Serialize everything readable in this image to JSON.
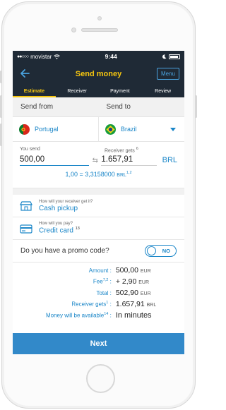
{
  "status_bar": {
    "carrier": "movistar",
    "time": "9:44"
  },
  "header": {
    "title": "Send money",
    "menu_label": "Menu"
  },
  "tabs": [
    {
      "label": "Estimate",
      "active": true
    },
    {
      "label": "Receiver",
      "active": false
    },
    {
      "label": "Payment",
      "active": false
    },
    {
      "label": "Review",
      "active": false
    }
  ],
  "send": {
    "from_label": "Send from",
    "to_label": "Send to",
    "from_country": "Portugal",
    "to_country": "Brazil"
  },
  "amounts": {
    "you_send_label": "You send",
    "receiver_gets_label": "Receiver gets",
    "receiver_gets_sup": "6",
    "you_send_value": "500,00",
    "receiver_gets_value": "1.657,91",
    "currency": "BRL",
    "rate_text": "1,00 = 3,3158000",
    "rate_currency": "BRL",
    "rate_sup": "1,2"
  },
  "receive_method": {
    "question": "How will your receiver get it?",
    "value": "Cash pickup"
  },
  "pay_method": {
    "question": "How will you pay?",
    "value": "Credit card",
    "sup": "13"
  },
  "promo": {
    "question": "Do you have a promo code?",
    "toggle_label": "NO"
  },
  "summary": {
    "amount_label": "Amount :",
    "amount_value": "500,00",
    "amount_cur": "EUR",
    "fee_label": "Fee",
    "fee_sup": "7,2",
    "fee_colon": " :",
    "fee_value": "+ 2,90",
    "fee_cur": "EUR",
    "total_label": "Total :",
    "total_value": "502,90",
    "total_cur": "EUR",
    "receiver_label": "Receiver gets",
    "receiver_sup": "1",
    "receiver_colon": " :",
    "receiver_value": "1.657,91",
    "receiver_cur": "BRL",
    "available_label": "Money will be available",
    "available_sup": "14",
    "available_colon": " :",
    "available_value": "In minutes"
  },
  "next_label": "Next",
  "colors": {
    "header_bg": "#1f2a36",
    "accent_yellow": "#f6c60f",
    "link_blue": "#1a86c8",
    "button_blue": "#3289c9"
  }
}
